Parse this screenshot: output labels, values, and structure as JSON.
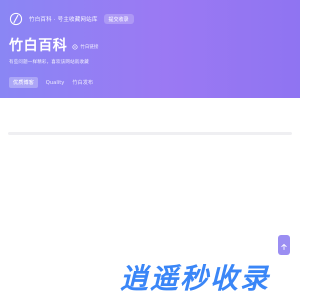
{
  "topbar": {
    "title": "竹白百科 · 号主收藏网站库",
    "sync_label": "提交收录"
  },
  "header": {
    "title": "竹白百科",
    "domain": "竹白链接",
    "description": "有些问题一样精彩，喜欢该网站就收藏"
  },
  "tabs": [
    {
      "label": "优质博客"
    },
    {
      "label": "Quality"
    },
    {
      "label": "竹白发布"
    }
  ],
  "watermark": {
    "text": "逍遥秒收录"
  },
  "colors": {
    "hero_start": "#8a86f4",
    "hero_end": "#8f74f2",
    "watermark": "#3a86f7",
    "side_button": "#9b8ef2"
  },
  "icons": {
    "logo": "bamboo-logo-icon",
    "domain": "link-icon",
    "side": "back-to-top-icon"
  }
}
